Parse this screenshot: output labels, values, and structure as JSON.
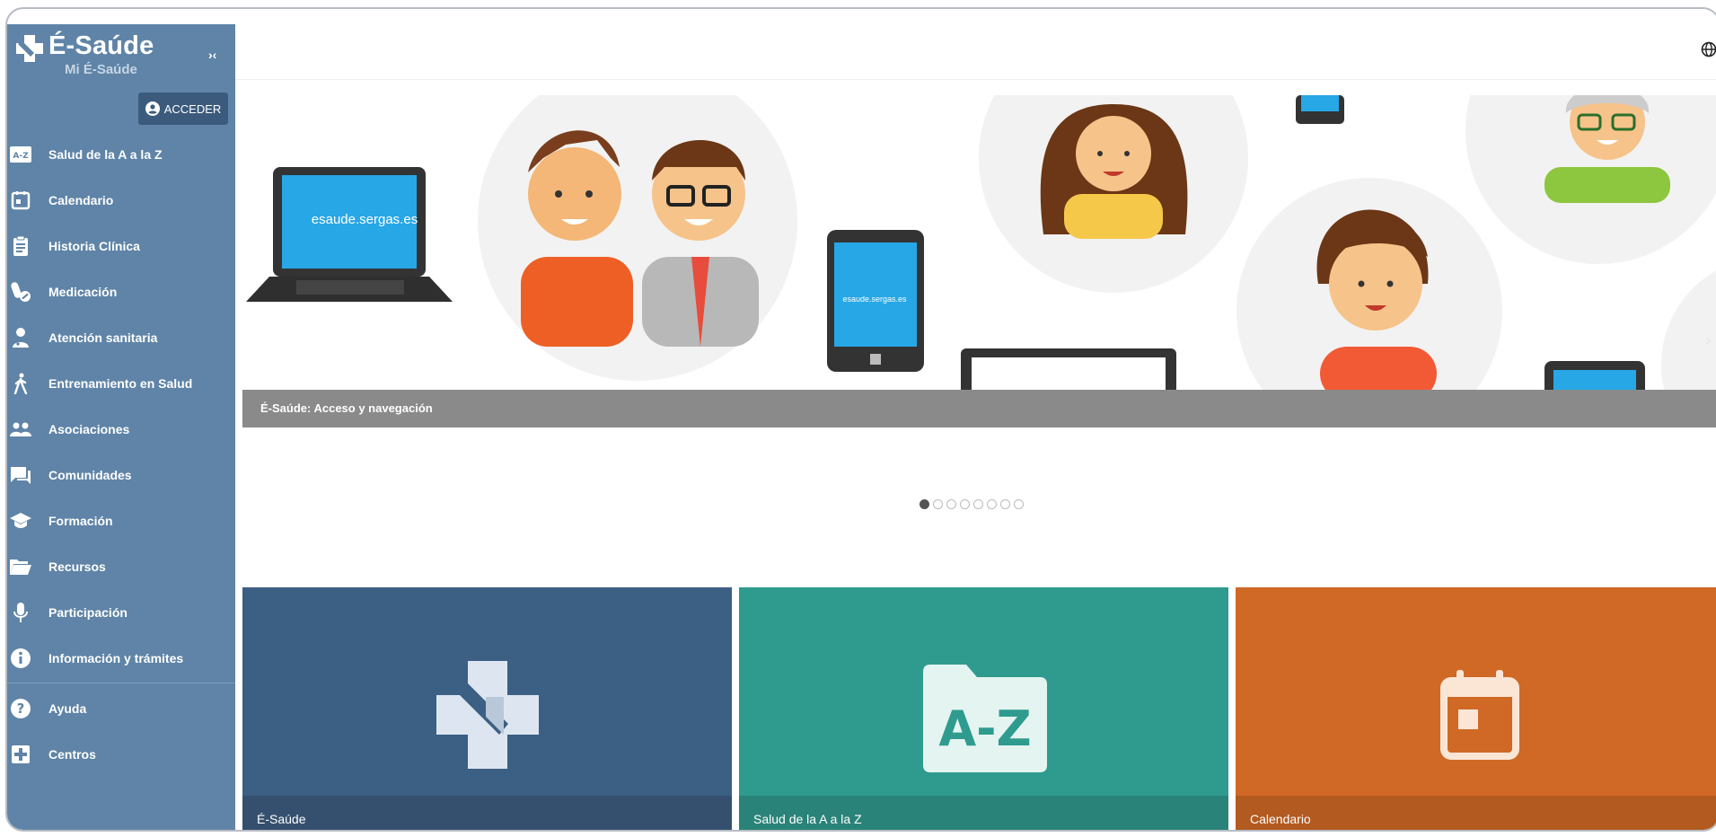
{
  "app": {
    "title": "É-Saúde",
    "subtitle": "Mi É-Saúde",
    "collapse_label": "›‹"
  },
  "sidebar": {
    "login_label": "ACCEDER",
    "items": [
      {
        "label": "Salud de la A a la Z",
        "icon": "a-z-icon"
      },
      {
        "label": "Calendario",
        "icon": "calendar-icon"
      },
      {
        "label": "Historia Clínica",
        "icon": "clipboard-icon"
      },
      {
        "label": "Medicación",
        "icon": "pills-icon"
      },
      {
        "label": "Atención sanitaria",
        "icon": "doctor-icon"
      },
      {
        "label": "Entrenamiento en Salud",
        "icon": "walking-icon"
      },
      {
        "label": "Asociaciones",
        "icon": "group-icon"
      },
      {
        "label": "Comunidades",
        "icon": "forum-icon"
      },
      {
        "label": "Formación",
        "icon": "graduation-cap-icon"
      },
      {
        "label": "Recursos",
        "icon": "folder-open-icon"
      },
      {
        "label": "Participación",
        "icon": "microphone-icon"
      },
      {
        "label": "Información y trámites",
        "icon": "info-icon"
      }
    ],
    "bottom_items": [
      {
        "label": "Ayuda",
        "icon": "help-icon"
      },
      {
        "label": "Centros",
        "icon": "plus-square-icon"
      }
    ]
  },
  "banner": {
    "caption": "É-Saúde: Acceso y navegación",
    "laptop_text": "esaude.sergas.es",
    "tablet_text": "esaude.sergas.es",
    "slides_total": 8,
    "active_slide": 1
  },
  "tiles": [
    {
      "label": "É-Saúde",
      "color": "#3c5f84",
      "foot_color": "#35506f",
      "icon": "esaude-logo-icon"
    },
    {
      "label": "Salud de la A a la Z",
      "color": "#2f9b8e",
      "foot_color": "#2a8378",
      "icon": "a-z-folder-icon",
      "icon_text": "A-Z"
    },
    {
      "label": "Calendario",
      "color": "#cf6925",
      "foot_color": "#b35a20",
      "icon": "calendar-icon"
    }
  ],
  "colors": {
    "sidebar": "#5f84a7",
    "login_button": "#3c5b7c",
    "caption_bar": "#8a8a8a"
  }
}
